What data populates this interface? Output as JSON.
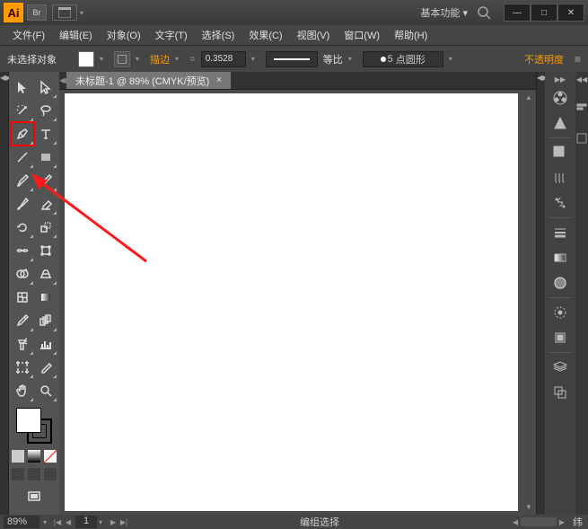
{
  "titlebar": {
    "logo": "Ai",
    "badge": "Br",
    "workspace": "基本功能"
  },
  "menu": {
    "file": "文件(F)",
    "edit": "编辑(E)",
    "object": "对象(O)",
    "text": "文字(T)",
    "select": "选择(S)",
    "effect": "效果(C)",
    "view": "视图(V)",
    "window": "窗口(W)",
    "help": "帮助(H)"
  },
  "options": {
    "no_selection": "未选择对象",
    "stroke_label": "描边",
    "stroke_weight": "0.3528",
    "scale_label": "等比",
    "brush_size": "5",
    "brush_label": "点圆形",
    "opacity_label": "不透明度"
  },
  "document": {
    "tab_title": "未标题-1 @ 89% (CMYK/预览)"
  },
  "status": {
    "zoom": "89%",
    "page": "1",
    "mode": "编组选择",
    "right_text": "纬"
  }
}
